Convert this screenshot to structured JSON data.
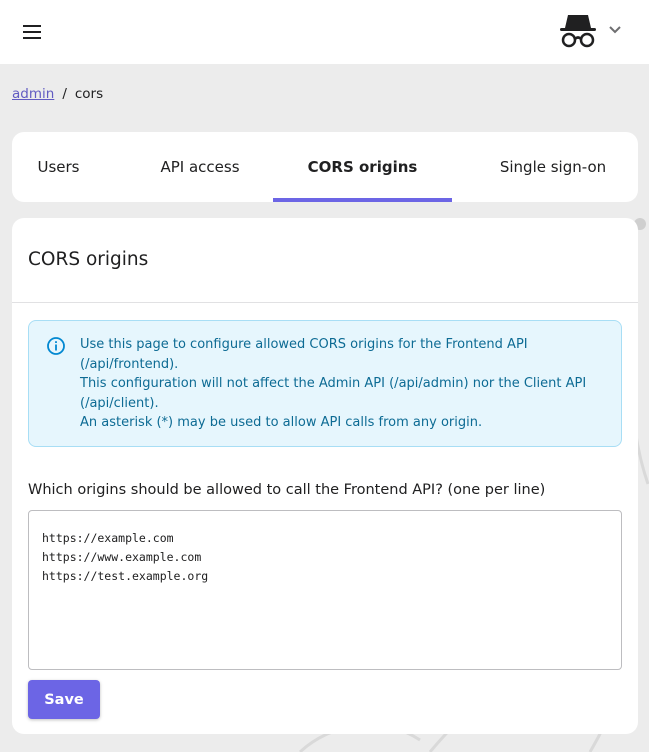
{
  "breadcrumb": {
    "root": "admin",
    "separator": "/",
    "current": "cors"
  },
  "tabs": [
    {
      "label": "Users"
    },
    {
      "label": "API access"
    },
    {
      "label": "CORS origins",
      "active": true
    },
    {
      "label": "Single sign-on"
    }
  ],
  "card": {
    "title": "CORS origins",
    "info_lines": [
      "Use this page to configure allowed CORS origins for the Frontend API (/api/frontend).",
      "This configuration will not affect the Admin API (/api/admin) nor the Client API (/api/client).",
      "An asterisk (*) may be used to allow API calls from any origin."
    ],
    "field_label": "Which origins should be allowed to call the Frontend API? (one per line)",
    "origins_value": "https://example.com\nhttps://www.example.com\nhttps://test.example.org",
    "save_label": "Save"
  },
  "icons": {
    "menu": "hamburger-menu-icon",
    "user": "incognito-user-icon",
    "chevron": "chevron-down-icon",
    "info": "info-icon"
  },
  "colors": {
    "accent": "#6c65e5",
    "link": "#615bc2",
    "info_bg": "#e6f6fd",
    "info_text": "#0d6b94",
    "info_border": "#a8def5"
  }
}
